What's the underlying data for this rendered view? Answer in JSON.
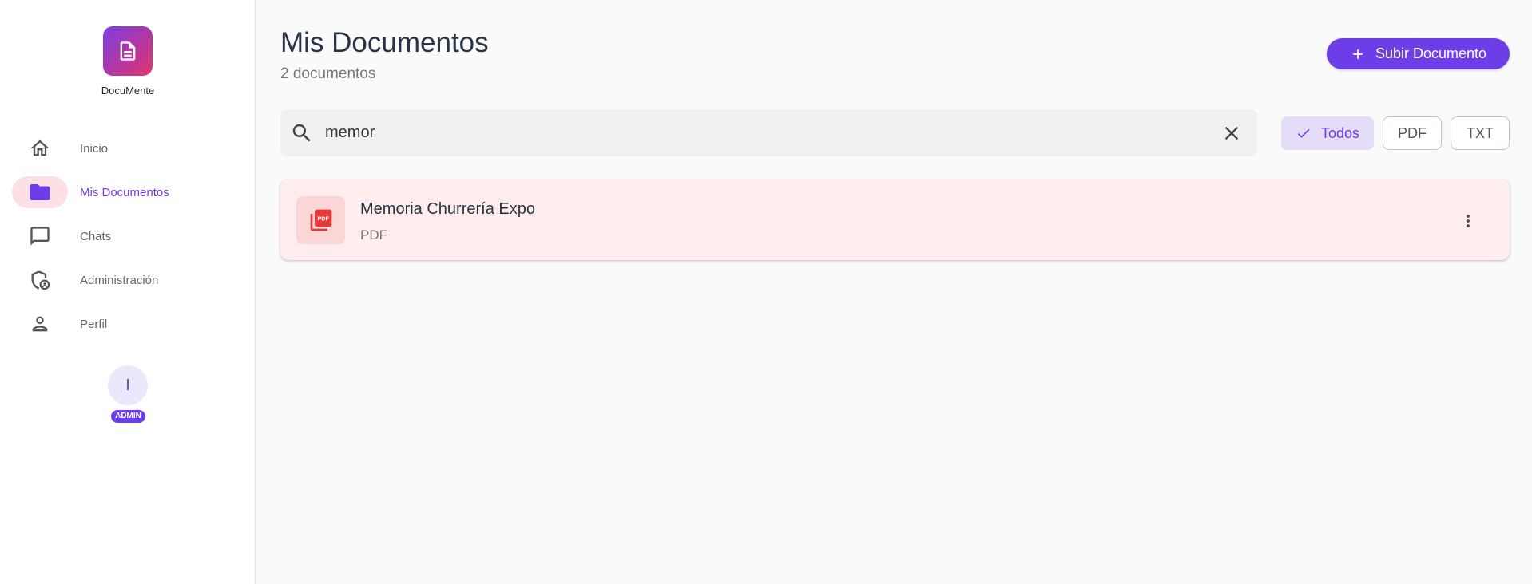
{
  "app": {
    "name": "DocuMente"
  },
  "sidebar": {
    "items": [
      {
        "label": "Inicio",
        "icon": "home-icon",
        "active": false
      },
      {
        "label": "Mis Documentos",
        "icon": "folder-icon",
        "active": true
      },
      {
        "label": "Chats",
        "icon": "chat-icon",
        "active": false
      },
      {
        "label": "Administración",
        "icon": "admin-shield-icon",
        "active": false
      },
      {
        "label": "Perfil",
        "icon": "person-icon",
        "active": false
      }
    ],
    "user": {
      "initial": "I",
      "role": "ADMIN"
    }
  },
  "header": {
    "title": "Mis Documentos",
    "subtitle": "2 documentos",
    "upload_label": "Subir Documento"
  },
  "search": {
    "value": "memor",
    "placeholder": ""
  },
  "filters": [
    {
      "label": "Todos",
      "selected": true
    },
    {
      "label": "PDF",
      "selected": false
    },
    {
      "label": "TXT",
      "selected": false
    }
  ],
  "documents": [
    {
      "name": "Memoria Churrería Expo",
      "type": "PDF",
      "icon": "pdf-icon"
    }
  ],
  "colors": {
    "accent": "#6d3ee8",
    "active_nav_bg": "#fde0e6",
    "card_bg": "#ffecec",
    "chip_selected_bg": "#e5dcf7"
  }
}
